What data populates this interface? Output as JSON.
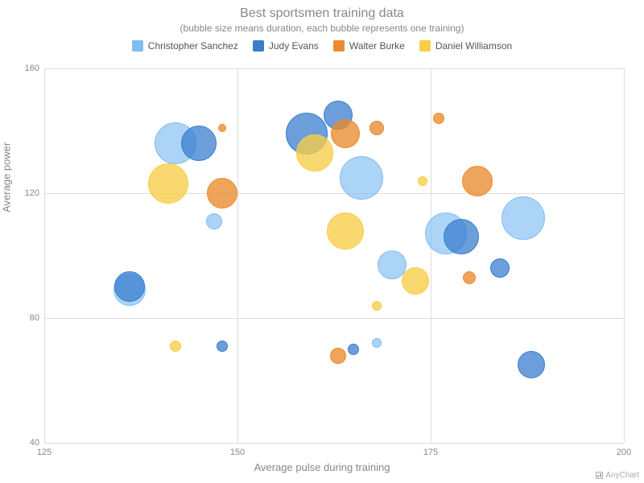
{
  "title": "Best sportsmen training data",
  "subtitle": "(bubble size means duration, each bubble represents one training)",
  "credit": "AnyChart",
  "chart_data": {
    "type": "bubble",
    "title": "Best sportsmen training data",
    "xlabel": "Average pulse during training",
    "ylabel": "Average power",
    "xlim": [
      125,
      200
    ],
    "ylim": [
      40,
      160
    ],
    "xticks": [
      125,
      150,
      175,
      200
    ],
    "yticks": [
      40,
      80,
      120,
      160
    ],
    "series": [
      {
        "name": "Christopher Sanchez",
        "color": "#80bdf2",
        "fill": "rgba(128,189,242,0.65)",
        "points": [
          {
            "x": 142,
            "y": 136,
            "size": 52
          },
          {
            "x": 147,
            "y": 111,
            "size": 20
          },
          {
            "x": 166,
            "y": 125,
            "size": 54
          },
          {
            "x": 170,
            "y": 97,
            "size": 36
          },
          {
            "x": 177,
            "y": 107,
            "size": 52
          },
          {
            "x": 187,
            "y": 112,
            "size": 54
          },
          {
            "x": 136,
            "y": 89,
            "size": 40
          },
          {
            "x": 168,
            "y": 72,
            "size": 12
          }
        ]
      },
      {
        "name": "Judy Evans",
        "color": "#3a7ecd",
        "fill": "rgba(58,126,205,0.75)",
        "points": [
          {
            "x": 145,
            "y": 136,
            "size": 44
          },
          {
            "x": 159,
            "y": 139,
            "size": 52
          },
          {
            "x": 163,
            "y": 145,
            "size": 36
          },
          {
            "x": 136,
            "y": 90,
            "size": 38
          },
          {
            "x": 148,
            "y": 71,
            "size": 14
          },
          {
            "x": 165,
            "y": 70,
            "size": 14
          },
          {
            "x": 179,
            "y": 106,
            "size": 44
          },
          {
            "x": 184,
            "y": 96,
            "size": 24
          },
          {
            "x": 188,
            "y": 65,
            "size": 34
          }
        ]
      },
      {
        "name": "Walter Burke",
        "color": "#eb8b2d",
        "fill": "rgba(235,139,45,0.78)",
        "points": [
          {
            "x": 148,
            "y": 120,
            "size": 38
          },
          {
            "x": 148,
            "y": 141,
            "size": 10
          },
          {
            "x": 164,
            "y": 139,
            "size": 36
          },
          {
            "x": 168,
            "y": 141,
            "size": 18
          },
          {
            "x": 176,
            "y": 144,
            "size": 14
          },
          {
            "x": 181,
            "y": 124,
            "size": 38
          },
          {
            "x": 180,
            "y": 93,
            "size": 16
          },
          {
            "x": 163,
            "y": 68,
            "size": 20
          }
        ]
      },
      {
        "name": "Daniel Williamson",
        "color": "#f7ce46",
        "fill": "rgba(247,206,70,0.78)",
        "points": [
          {
            "x": 141,
            "y": 123,
            "size": 50
          },
          {
            "x": 160,
            "y": 133,
            "size": 46
          },
          {
            "x": 164,
            "y": 108,
            "size": 46
          },
          {
            "x": 174,
            "y": 124,
            "size": 12
          },
          {
            "x": 173,
            "y": 92,
            "size": 34
          },
          {
            "x": 168,
            "y": 84,
            "size": 12
          },
          {
            "x": 142,
            "y": 71,
            "size": 14
          }
        ]
      }
    ]
  }
}
